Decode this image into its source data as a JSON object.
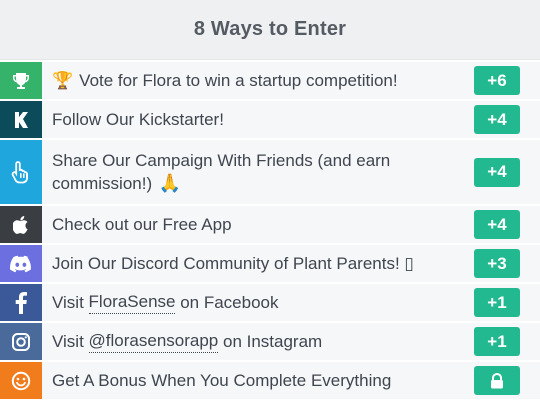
{
  "header": {
    "title": "8 Ways to Enter"
  },
  "entries": [
    {
      "trophy_emoji": "🏆",
      "label": "Vote for Flora to win a startup competition!",
      "points": "+6",
      "icon": "trophy-icon",
      "color": "#36b36b"
    },
    {
      "label": "Follow Our Kickstarter!",
      "points": "+4",
      "icon": "kickstarter-icon",
      "color": "#0c4b5a"
    },
    {
      "label": "Share Our Campaign With Friends (and earn commission!)",
      "emoji": "🙏",
      "points": "+4",
      "icon": "hand-pointer-icon",
      "color": "#1fa6dd"
    },
    {
      "label": "Check out our Free App",
      "points": "+4",
      "icon": "apple-icon",
      "color": "#3a3d42"
    },
    {
      "label": "Join Our Discord Community of Plant Parents! ▯",
      "points": "+3",
      "icon": "discord-icon",
      "color": "#6b6fe0"
    },
    {
      "prefix": "Visit ",
      "link": "FloraSense",
      "suffix": " on Facebook",
      "points": "+1",
      "icon": "facebook-icon",
      "color": "#3b5998"
    },
    {
      "prefix": "Visit ",
      "link": "@florasensorapp",
      "suffix": " on Instagram",
      "points": "+1",
      "icon": "instagram-icon",
      "color": "#4a6a9c"
    },
    {
      "label": "Get A Bonus When You Complete Everything",
      "icon": "smile-icon",
      "badge_icon": "lock-icon",
      "color": "#f07c1c"
    }
  ],
  "badge_color": "#22b990"
}
